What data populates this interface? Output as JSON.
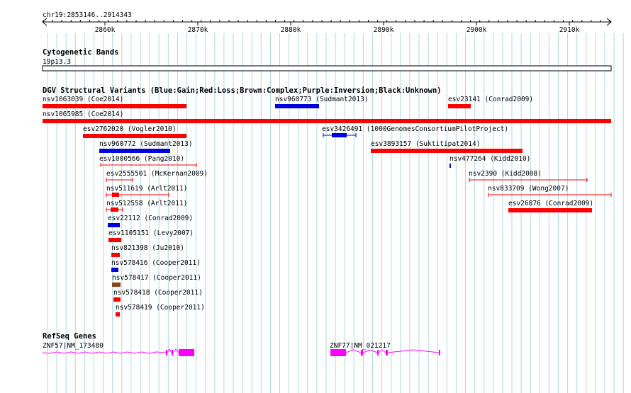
{
  "ruler": {
    "label": "chr19:2853146..2914343",
    "ticks": [
      "2860k",
      "2870k",
      "2880k",
      "2890k",
      "2900k",
      "2910k"
    ]
  },
  "tracks": {
    "cytoband": {
      "title": "Cytogenetic Bands",
      "band": "19p13.3"
    },
    "dgv": {
      "title": "DGV Structural Variants (Blue:Gain;Red:Loss;Brown:Complex;Purple:Inversion;Black:Unknown)"
    },
    "refseq": {
      "title": "RefSeq Genes"
    }
  },
  "colors": {
    "gain": "#0000dd",
    "loss": "#ff0000",
    "complex": "#8b4513",
    "gene": "#ff00ff",
    "grid": "#add8e6"
  },
  "dgv_features": [
    {
      "label": "nsv1063039 (Coe2014)",
      "type": "loss",
      "style": "bar"
    },
    {
      "label": "nsv960773 (Sudmant2013)",
      "type": "gain",
      "style": "bar"
    },
    {
      "label": "esv23141 (Conrad2009)",
      "type": "loss",
      "style": "bar"
    },
    {
      "label": "nsv1065985 (Coe2014)",
      "type": "loss",
      "style": "bar"
    },
    {
      "label": "esv2762020 (Vogler2010)",
      "type": "loss",
      "style": "bar"
    },
    {
      "label": "esv3426491 (1000GenomesConsortiumPilotProject)",
      "type": "gain",
      "style": "range"
    },
    {
      "label": "nsv960772 (Sudmant2013)",
      "type": "gain",
      "style": "bar"
    },
    {
      "label": "esv3893157 (Suktitipat2014)",
      "type": "loss",
      "style": "bar"
    },
    {
      "label": "esv1000566 (Pang2010)",
      "type": "loss",
      "style": "range"
    },
    {
      "label": "nsv477264 (Kidd2010)",
      "type": "gain",
      "style": "bar"
    },
    {
      "label": "esv2555501 (McKernan2009)",
      "type": "loss",
      "style": "range"
    },
    {
      "label": "nsv2390 (Kidd2008)",
      "type": "loss",
      "style": "range"
    },
    {
      "label": "nsv511619 (Arlt2011)",
      "type": "loss",
      "style": "range"
    },
    {
      "label": "nsv833709 (Wong2007)",
      "type": "loss",
      "style": "range"
    },
    {
      "label": "nsv512558 (Arlt2011)",
      "type": "loss",
      "style": "range"
    },
    {
      "label": "esv26876 (Conrad2009)",
      "type": "loss",
      "style": "bar"
    },
    {
      "label": "esv22112 (Conrad2009)",
      "type": "gain",
      "style": "bar"
    },
    {
      "label": "esv1105151 (Levy2007)",
      "type": "loss",
      "style": "bar"
    },
    {
      "label": "nsv821398 (Ju2010)",
      "type": "loss",
      "style": "bar"
    },
    {
      "label": "nsv578416 (Cooper2011)",
      "type": "gain",
      "style": "bar"
    },
    {
      "label": "nsv578417 (Cooper2011)",
      "type": "complex",
      "style": "bar"
    },
    {
      "label": "nsv578418 (Cooper2011)",
      "type": "loss",
      "style": "bar"
    },
    {
      "label": "nsv578419 (Cooper2011)",
      "type": "loss",
      "style": "bar"
    }
  ],
  "genes": [
    {
      "label": "ZNF57|NM_173480"
    },
    {
      "label": "ZNF77|NM_021217"
    }
  ]
}
